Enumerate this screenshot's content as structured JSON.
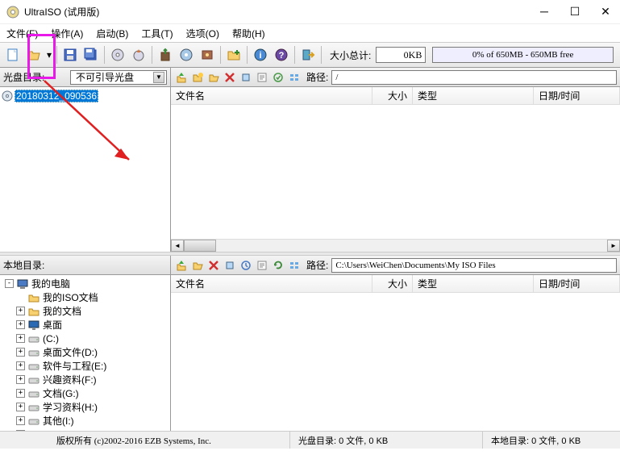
{
  "titlebar": {
    "title": "UltraISO (试用版)"
  },
  "menu": {
    "items": [
      "文件(F)",
      "操作(A)",
      "启动(B)",
      "工具(T)",
      "选项(O)",
      "帮助(H)"
    ]
  },
  "toolbar": {
    "size_label": "大小总计:",
    "size_value": "0KB",
    "progress_text": "0% of 650MB - 650MB free"
  },
  "upper_left": {
    "header": "光盘目录:",
    "bootable": "不可引导光盘",
    "tree_item": "20180312_090536"
  },
  "upper_right": {
    "path_label": "路径:",
    "path_value": "/",
    "cols": {
      "name": "文件名",
      "size": "大小",
      "type": "类型",
      "date": "日期/时间"
    }
  },
  "lower_left": {
    "header": "本地目录:",
    "tree": [
      {
        "icon": "computer",
        "label": "我的电脑",
        "indent": 0,
        "exp": "-"
      },
      {
        "icon": "hl-folder",
        "label": "我的ISO文档",
        "indent": 1,
        "exp": ""
      },
      {
        "icon": "folder",
        "label": "我的文档",
        "indent": 1,
        "exp": "+"
      },
      {
        "icon": "desktop",
        "label": "桌面",
        "indent": 1,
        "exp": "+"
      },
      {
        "icon": "drive",
        "label": "(C:)",
        "indent": 1,
        "exp": "+"
      },
      {
        "icon": "drive",
        "label": "桌面文件(D:)",
        "indent": 1,
        "exp": "+"
      },
      {
        "icon": "drive",
        "label": "软件与工程(E:)",
        "indent": 1,
        "exp": "+"
      },
      {
        "icon": "drive",
        "label": "兴趣资料(F:)",
        "indent": 1,
        "exp": "+"
      },
      {
        "icon": "drive",
        "label": "文档(G:)",
        "indent": 1,
        "exp": "+"
      },
      {
        "icon": "drive",
        "label": "学习资料(H:)",
        "indent": 1,
        "exp": "+"
      },
      {
        "icon": "drive",
        "label": "其他(I:)",
        "indent": 1,
        "exp": "+"
      },
      {
        "icon": "drive",
        "label": "NO NAME(T:)",
        "indent": 1,
        "exp": "+"
      }
    ]
  },
  "lower_right": {
    "path_label": "路径:",
    "path_value": "C:\\Users\\WeiChen\\Documents\\My ISO Files",
    "cols": {
      "name": "文件名",
      "size": "大小",
      "type": "类型",
      "date": "日期/时间"
    }
  },
  "statusbar": {
    "copyright": "版权所有 (c)2002-2016 EZB Systems, Inc.",
    "disc": "光盘目录: 0 文件, 0 KB",
    "local": "本地目录: 0 文件, 0 KB"
  }
}
